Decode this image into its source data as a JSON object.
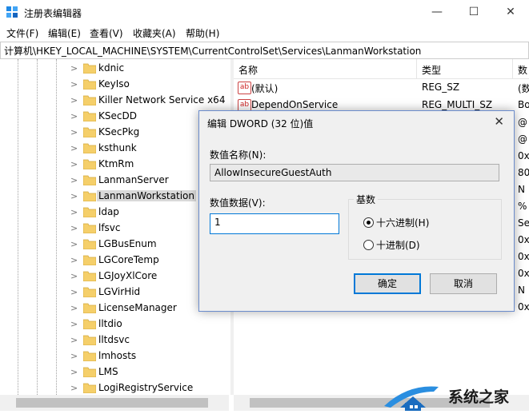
{
  "window": {
    "title": "注册表编辑器",
    "minimize": "—",
    "maximize": "☐",
    "close": "✕"
  },
  "menu": [
    "文件(F)",
    "编辑(E)",
    "查看(V)",
    "收藏夹(A)",
    "帮助(H)"
  ],
  "address": "计算机\\HKEY_LOCAL_MACHINE\\SYSTEM\\CurrentControlSet\\Services\\LanmanWorkstation",
  "tree": {
    "items": [
      "kdnic",
      "KeyIso",
      "Killer Network Service x64",
      "KSecDD",
      "KSecPkg",
      "ksthunk",
      "KtmRm",
      "LanmanServer",
      "LanmanWorkstation",
      "ldap",
      "lfsvc",
      "LGBusEnum",
      "LGCoreTemp",
      "LGJoyXlCore",
      "LGVirHid",
      "LicenseManager",
      "lltdio",
      "lltdsvc",
      "lmhosts",
      "LMS",
      "LogiRegistryService"
    ],
    "selected": "LanmanWorkstation"
  },
  "list": {
    "headers": {
      "name": "名称",
      "type": "类型",
      "data": "数"
    },
    "rows": [
      {
        "name": "(默认)",
        "type": "REG_SZ",
        "data": "(数"
      },
      {
        "name": "DependOnService",
        "type": "REG_MULTI_SZ",
        "data": "Bo"
      }
    ],
    "clipped_data": [
      "@",
      "@",
      "0x",
      "80",
      "N",
      "%",
      "Se",
      "0x",
      "0x",
      "0x",
      "N",
      "0x"
    ]
  },
  "dialog": {
    "title": "编辑 DWORD (32 位)值",
    "close": "✕",
    "name_label": "数值名称(N):",
    "name_value": "AllowInsecureGuestAuth",
    "data_label": "数值数据(V):",
    "data_value": "1",
    "base_label": "基数",
    "radio_hex": "十六进制(H)",
    "radio_dec": "十进制(D)",
    "selected_base": "hex",
    "ok": "确定",
    "cancel": "取消"
  },
  "watermark": {
    "text": "系统之家"
  },
  "colors": {
    "accent": "#0078d7",
    "folder": "#f5cf6a",
    "dialog_bg": "#f0f0f0",
    "selection": "#d9d9d9"
  }
}
